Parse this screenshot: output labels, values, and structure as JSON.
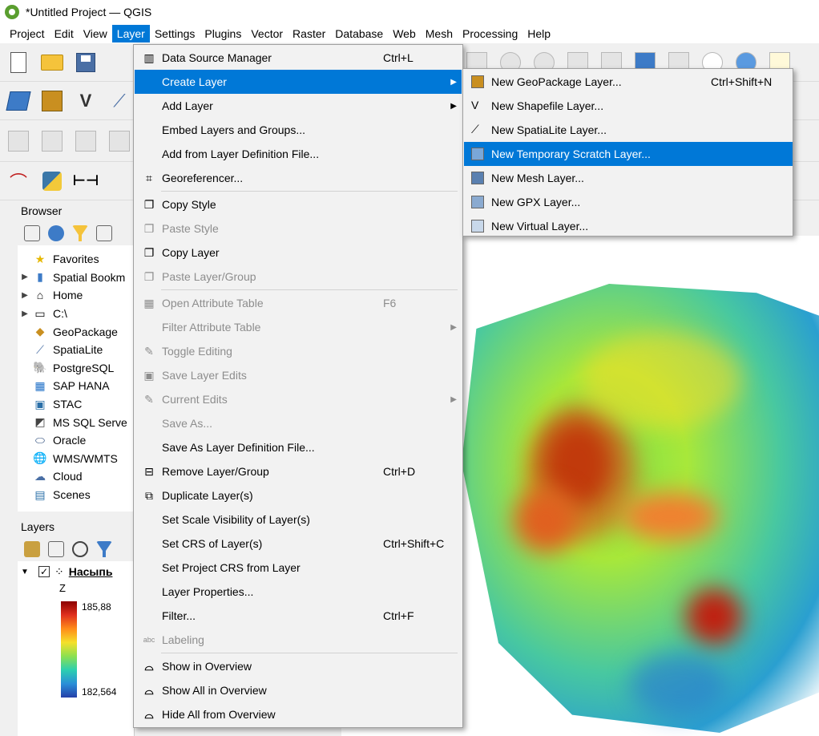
{
  "window": {
    "title": "*Untitled Project — QGIS"
  },
  "menubar": {
    "items": [
      "Project",
      "Edit",
      "View",
      "Layer",
      "Settings",
      "Plugins",
      "Vector",
      "Raster",
      "Database",
      "Web",
      "Mesh",
      "Processing",
      "Help"
    ],
    "active": "Layer"
  },
  "browser": {
    "title": "Browser",
    "items": [
      {
        "label": "Favorites",
        "icon": "star-icon",
        "expandable": false
      },
      {
        "label": "Spatial Bookm",
        "icon": "bookmark-icon",
        "expandable": true
      },
      {
        "label": "Home",
        "icon": "home-icon",
        "expandable": true
      },
      {
        "label": "C:\\",
        "icon": "drive-icon",
        "expandable": true
      },
      {
        "label": "GeoPackage",
        "icon": "geopackage-icon",
        "expandable": false
      },
      {
        "label": "SpatiaLite",
        "icon": "spatialite-icon",
        "expandable": false
      },
      {
        "label": "PostgreSQL",
        "icon": "postgresql-icon",
        "expandable": false
      },
      {
        "label": "SAP HANA",
        "icon": "sap-hana-icon",
        "expandable": false
      },
      {
        "label": "STAC",
        "icon": "stac-icon",
        "expandable": false
      },
      {
        "label": "MS SQL Serve",
        "icon": "mssql-icon",
        "expandable": false
      },
      {
        "label": "Oracle",
        "icon": "oracle-icon",
        "expandable": false
      },
      {
        "label": "WMS/WMTS",
        "icon": "wms-icon",
        "expandable": false
      },
      {
        "label": "Cloud",
        "icon": "cloud-icon",
        "expandable": false
      },
      {
        "label": "Scenes",
        "icon": "scenes-icon",
        "expandable": false
      }
    ]
  },
  "layers_panel": {
    "title": "Layers",
    "layer_name": "Насыпь",
    "legend_field": "Z",
    "legend_max": "185,88",
    "legend_min": "182,564"
  },
  "layer_menu": {
    "items": [
      {
        "label": "Data Source Manager",
        "shortcut": "Ctrl+L",
        "icon": "data-source-manager-icon",
        "state": "normal"
      },
      {
        "label": "Create Layer",
        "shortcut": "",
        "icon": "",
        "state": "highlighted",
        "submenu": true
      },
      {
        "label": "Add Layer",
        "shortcut": "",
        "icon": "",
        "state": "normal",
        "submenu": true
      },
      {
        "label": "Embed Layers and Groups...",
        "shortcut": "",
        "icon": "",
        "state": "normal"
      },
      {
        "label": "Add from Layer Definition File...",
        "shortcut": "",
        "icon": "",
        "state": "normal"
      },
      {
        "label": "Georeferencer...",
        "shortcut": "",
        "icon": "georeferencer-icon",
        "state": "normal"
      },
      {
        "sep": true
      },
      {
        "label": "Copy Style",
        "shortcut": "",
        "icon": "copy-style-icon",
        "state": "normal"
      },
      {
        "label": "Paste Style",
        "shortcut": "",
        "icon": "paste-style-icon",
        "state": "disabled"
      },
      {
        "label": "Copy Layer",
        "shortcut": "",
        "icon": "copy-layer-icon",
        "state": "normal"
      },
      {
        "label": "Paste Layer/Group",
        "shortcut": "",
        "icon": "paste-layer-icon",
        "state": "disabled"
      },
      {
        "sep": true
      },
      {
        "label": "Open Attribute Table",
        "shortcut": "F6",
        "icon": "attribute-table-icon",
        "state": "disabled"
      },
      {
        "label": "Filter Attribute Table",
        "shortcut": "",
        "icon": "",
        "state": "disabled",
        "submenu": true
      },
      {
        "label": "Toggle Editing",
        "shortcut": "",
        "icon": "pencil-icon",
        "state": "disabled"
      },
      {
        "label": "Save Layer Edits",
        "shortcut": "",
        "icon": "save-edits-icon",
        "state": "disabled"
      },
      {
        "label": "Current Edits",
        "shortcut": "",
        "icon": "current-edits-icon",
        "state": "disabled",
        "submenu": true
      },
      {
        "label": "Save As...",
        "shortcut": "",
        "icon": "",
        "state": "disabled"
      },
      {
        "label": "Save As Layer Definition File...",
        "shortcut": "",
        "icon": "",
        "state": "normal"
      },
      {
        "label": "Remove Layer/Group",
        "shortcut": "Ctrl+D",
        "icon": "remove-layer-icon",
        "state": "normal"
      },
      {
        "label": "Duplicate Layer(s)",
        "shortcut": "",
        "icon": "duplicate-layer-icon",
        "state": "normal"
      },
      {
        "label": "Set Scale Visibility of Layer(s)",
        "shortcut": "",
        "icon": "",
        "state": "normal"
      },
      {
        "label": "Set CRS of Layer(s)",
        "shortcut": "Ctrl+Shift+C",
        "icon": "",
        "state": "normal"
      },
      {
        "label": "Set Project CRS from Layer",
        "shortcut": "",
        "icon": "",
        "state": "normal"
      },
      {
        "label": "Layer Properties...",
        "shortcut": "",
        "icon": "",
        "state": "normal"
      },
      {
        "label": "Filter...",
        "shortcut": "Ctrl+F",
        "icon": "",
        "state": "normal"
      },
      {
        "label": "Labeling",
        "shortcut": "",
        "icon": "labeling-icon",
        "state": "disabled"
      },
      {
        "sep": true
      },
      {
        "label": "Show in Overview",
        "shortcut": "",
        "icon": "glasses-add-icon",
        "state": "normal"
      },
      {
        "label": "Show All in Overview",
        "shortcut": "",
        "icon": "glasses-icon",
        "state": "normal"
      },
      {
        "label": "Hide All from Overview",
        "shortcut": "",
        "icon": "glasses-remove-icon",
        "state": "normal"
      }
    ]
  },
  "create_layer_submenu": {
    "items": [
      {
        "label": "New GeoPackage Layer...",
        "shortcut": "Ctrl+Shift+N",
        "icon": "new-geopackage-icon",
        "highlighted": false
      },
      {
        "label": "New Shapefile Layer...",
        "shortcut": "",
        "icon": "new-shapefile-icon",
        "highlighted": false
      },
      {
        "label": "New SpatiaLite Layer...",
        "shortcut": "",
        "icon": "new-spatialite-icon",
        "highlighted": false
      },
      {
        "label": "New Temporary Scratch Layer...",
        "shortcut": "",
        "icon": "new-scratch-layer-icon",
        "highlighted": true
      },
      {
        "label": "New Mesh Layer...",
        "shortcut": "",
        "icon": "new-mesh-icon",
        "highlighted": false
      },
      {
        "label": "New GPX Layer...",
        "shortcut": "",
        "icon": "new-gpx-icon",
        "highlighted": false
      },
      {
        "label": "New Virtual Layer...",
        "shortcut": "",
        "icon": "new-virtual-layer-icon",
        "highlighted": false
      }
    ]
  },
  "colors": {
    "highlight": "#0078d7",
    "menu_bg": "#f2f2f2",
    "disabled_text": "#8d8d8d"
  }
}
